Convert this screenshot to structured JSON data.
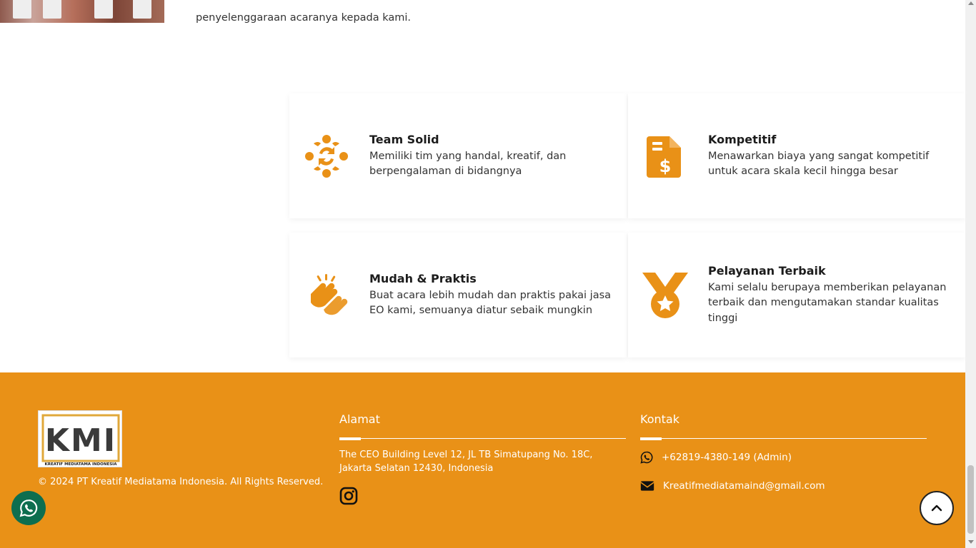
{
  "top": {
    "partial_text": "penyelenggaraan acaranya kepada kami."
  },
  "features": [
    {
      "icon": "team-icon",
      "title": "Team Solid",
      "description": "Memiliki tim yang handal, kreatif, dan berpengalaman di bidangnya"
    },
    {
      "icon": "invoice-dollar-icon",
      "title": "Kompetitif",
      "description": "Menawarkan biaya yang sangat kompetitif untuk acara skala kecil hingga besar"
    },
    {
      "icon": "hands-icon",
      "title": "Mudah & Praktis",
      "description": "Buat acara lebih mudah dan praktis pakai jasa EO kami, semuanya diatur sebaik mungkin"
    },
    {
      "icon": "medal-icon",
      "title": "Pelayanan Terbaik",
      "description": "Kami selalu berupaya memberikan pelayanan terbaik dan mengutamakan standar kualitas tinggi"
    }
  ],
  "footer": {
    "logo_text": "KMI",
    "logo_subtext": "KREATIF MEDIATAMA INDONESIA",
    "copyright": "© 2024 PT Kreatif Mediatama Indonesia. All Rights Reserved.",
    "address_title": "Alamat",
    "address": "The CEO Building Level 12, JL TB Simatupang No. 18C, Jakarta Selatan 12430, Indonesia",
    "contact_title": "Kontak",
    "phone": "+62819-4380-149 (Admin)",
    "email": "Kreatifmediatamaind@gmail.com"
  },
  "colors": {
    "accent": "#e99117",
    "whatsapp_float": "#0d6e4f"
  }
}
